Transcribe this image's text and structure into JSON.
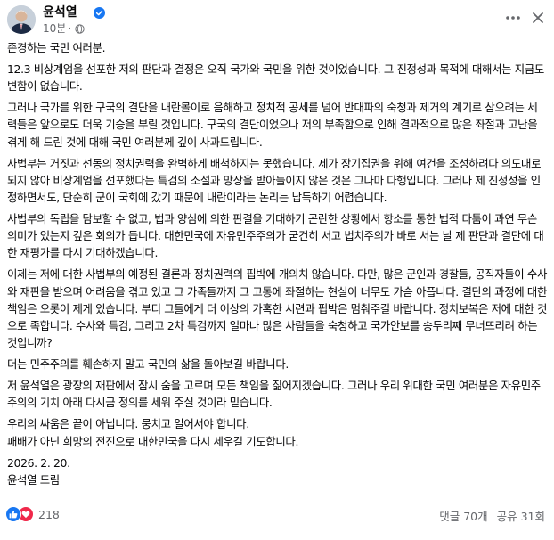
{
  "post": {
    "author": "윤석열",
    "time": "10분",
    "paragraphs": [
      "존경하는 국민 여러분.",
      "12.3 비상계엄을 선포한 저의 판단과 결정은 오직 국가와 국민을 위한 것이었습니다. 그 진정성과 목적에 대해서는 지금도 변함이 없습니다.",
      "그러나 국가를 위한 구국의 결단을 내란몰이로 음해하고 정치적 공세를 넘어 반대파의 숙청과 제거의 계기로 삼으려는 세력들은 앞으로도 더욱 기승을 부릴 것입니다. 구국의 결단이었으나 저의 부족함으로 인해 결과적으로 많은 좌절과 고난을 겪게 해 드린 것에 대해 국민 여러분께 깊이 사과드립니다.",
      "사법부는 거짓과 선동의 정치권력을 완벽하게 배척하지는 못했습니다. 제가 장기집권을 위해 여건을 조성하려다 의도대로 되지 않아 비상계엄을 선포했다는 특검의 소설과 망상을 받아들이지 않은 것은 그나마 다행입니다. 그러나 제 진정성을 인정하면서도, 단순히 군이 국회에 갔기 때문에 내란이라는 논리는 납득하기 어렵습니다.",
      "사법부의 독립을 담보할 수 없고, 법과 양심에 의한 판결을 기대하기 곤란한 상황에서 항소를 통한 법적 다툼이 과연 무슨 의미가 있는지 깊은 회의가 듭니다. 대한민국에 자유민주주의가 굳건히 서고 법치주의가 바로 서는 날 제 판단과 결단에 대한 재평가를 다시 기대하겠습니다.",
      "이제는 저에 대한 사법부의 예정된 결론과 정치권력의 핍박에 개의치 않습니다. 다만, 많은 군인과 경찰들, 공직자들이 수사와 재판을 받으며 어려움을 겪고 있고 그 가족들까지 그 고통에 좌절하는 현실이 너무도 가슴 아픕니다. 결단의 과정에 대한 책임은 오롯이 제게 있습니다. 부디 그들에게 더 이상의 가혹한 시련과 핍박은 멈춰주길 바랍니다. 정치보복은 저에 대한 것으로 족합니다. 수사와 특검, 그리고 2차 특검까지 얼마나 많은 사람들을 숙청하고 국가안보를 송두리째 무너뜨리려 하는 것입니까?",
      "더는 민주주의를 훼손하지 말고 국민의 삶을 돌아보길 바랍니다.",
      "저 윤석열은 광장의 재판에서 잠시 숨을 고르며 모든 책임을 짊어지겠습니다. 그러나 우리 위대한 국민 여러분은 자유민주주의의 기치 아래 다시금 정의를 세워 주실 것이라 믿습니다.",
      "우리의 싸움은 끝이 아닙니다. 뭉치고 일어서야 합니다.\n패배가 아닌 희망의 전진으로 대한민국을 다시 세우길 기도합니다.",
      "2026. 2. 20.\n윤석열 드림"
    ]
  },
  "footer": {
    "reaction_count": "218",
    "comments": "댓글 70개",
    "shares": "공유 31회"
  },
  "icons": {
    "verified": "verified-badge-icon",
    "privacy": "globe-icon",
    "more": "more-horizontal-icon",
    "close": "close-icon",
    "like": "like-icon",
    "love": "love-icon"
  },
  "colors": {
    "brand_blue": "#1877f2",
    "love_red": "#f0284a",
    "meta_gray": "#65676b",
    "text": "#080809"
  }
}
